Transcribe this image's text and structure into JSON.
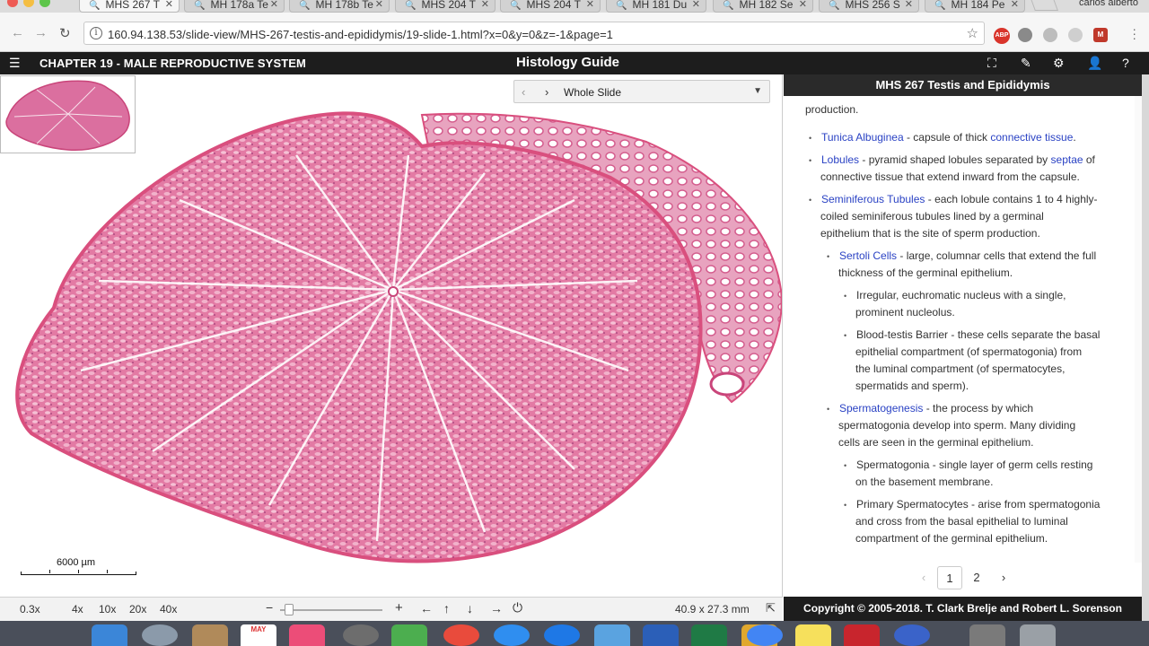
{
  "browser": {
    "tabs": [
      {
        "label": "MHS 267 T",
        "active": true
      },
      {
        "label": "MH 178a Te",
        "active": false
      },
      {
        "label": "MH 178b Te",
        "active": false
      },
      {
        "label": "MHS 204 T",
        "active": false
      },
      {
        "label": "MHS 204 T",
        "active": false
      },
      {
        "label": "MH 181 Du",
        "active": false
      },
      {
        "label": "MH 182 Se",
        "active": false
      },
      {
        "label": "MHS 256 S",
        "active": false
      },
      {
        "label": "MH 184 Pe",
        "active": false
      }
    ],
    "profile_name": "carlos alberto",
    "url": "160.94.138.53/slide-view/MHS-267-testis-and-epididymis/19-slide-1.html?x=0&y=0&z=-1&page=1",
    "extensions": [
      "ABP",
      "",
      "",
      "",
      "M"
    ]
  },
  "header": {
    "chapter": "CHAPTER 19 - MALE REPRODUCTIVE SYSTEM",
    "brand": "Histology Guide"
  },
  "viewer": {
    "slide_name": "Whole Slide",
    "scale_label": "6000 µm"
  },
  "panel": {
    "title": "MHS 267 Testis and Epididymis",
    "lines": [
      {
        "indent": 0,
        "bullet": false,
        "parts": [
          {
            "t": "production.",
            "link": false
          }
        ]
      },
      {
        "indent": 1,
        "bullet": true,
        "parts": [
          {
            "t": "Tunica Albuginea",
            "link": true
          },
          {
            "t": " - capsule of thick ",
            "link": false
          },
          {
            "t": "connective tissue",
            "link": true
          },
          {
            "t": ".",
            "link": false
          }
        ]
      },
      {
        "indent": 1,
        "bullet": true,
        "parts": [
          {
            "t": "Lobules",
            "link": true
          },
          {
            "t": " - pyramid shaped lobules separated by ",
            "link": false
          },
          {
            "t": "septae",
            "link": true
          },
          {
            "t": " of",
            "link": false
          }
        ]
      },
      {
        "indent": 1,
        "bullet": false,
        "parts": [
          {
            "t": "connective tissue that extend inward from the capsule.",
            "link": false
          }
        ]
      },
      {
        "indent": 1,
        "bullet": true,
        "parts": [
          {
            "t": "Seminiferous Tubules",
            "link": true
          },
          {
            "t": " - each lobule contains 1 to 4 highly-",
            "link": false
          }
        ]
      },
      {
        "indent": 1,
        "bullet": false,
        "parts": [
          {
            "t": "coiled seminiferous tubules lined by a germinal",
            "link": false
          }
        ]
      },
      {
        "indent": 1,
        "bullet": false,
        "parts": [
          {
            "t": "epithelium that is the site of sperm production.",
            "link": false
          }
        ]
      },
      {
        "indent": 2,
        "bullet": true,
        "parts": [
          {
            "t": "Sertoli Cells",
            "link": true
          },
          {
            "t": " - large, columnar cells that extend the full",
            "link": false
          }
        ]
      },
      {
        "indent": 2,
        "bullet": false,
        "parts": [
          {
            "t": "thickness of the germinal epithelium.",
            "link": false
          }
        ]
      },
      {
        "indent": 3,
        "bullet": true,
        "parts": [
          {
            "t": "Irregular, euchromatic nucleus with a single,",
            "link": false
          }
        ]
      },
      {
        "indent": 3,
        "bullet": false,
        "parts": [
          {
            "t": "prominent nucleolus.",
            "link": false
          }
        ]
      },
      {
        "indent": 3,
        "bullet": true,
        "parts": [
          {
            "t": "Blood-testis Barrier - these cells separate the basal",
            "link": false
          }
        ]
      },
      {
        "indent": 3,
        "bullet": false,
        "parts": [
          {
            "t": "epithelial compartment (of spermatogonia) from",
            "link": false
          }
        ]
      },
      {
        "indent": 3,
        "bullet": false,
        "parts": [
          {
            "t": "the luminal compartment (of spermatocytes,",
            "link": false
          }
        ]
      },
      {
        "indent": 3,
        "bullet": false,
        "parts": [
          {
            "t": "spermatids and sperm).",
            "link": false
          }
        ]
      },
      {
        "indent": 2,
        "bullet": true,
        "parts": [
          {
            "t": "Spermatogenesis",
            "link": true
          },
          {
            "t": " - the process by which",
            "link": false
          }
        ]
      },
      {
        "indent": 2,
        "bullet": false,
        "parts": [
          {
            "t": "spermatogonia develop into sperm. Many dividing",
            "link": false
          }
        ]
      },
      {
        "indent": 2,
        "bullet": false,
        "parts": [
          {
            "t": "cells are seen in the germinal epithelium.",
            "link": false
          }
        ]
      },
      {
        "indent": 3,
        "bullet": true,
        "parts": [
          {
            "t": "Spermatogonia - single layer of germ cells resting",
            "link": false
          }
        ]
      },
      {
        "indent": 3,
        "bullet": false,
        "parts": [
          {
            "t": "on the basement membrane.",
            "link": false
          }
        ]
      },
      {
        "indent": 3,
        "bullet": true,
        "parts": [
          {
            "t": "Primary Spermatocytes - arise from spermatogonia",
            "link": false
          }
        ]
      },
      {
        "indent": 3,
        "bullet": false,
        "parts": [
          {
            "t": "and cross from the basal epithelial to luminal",
            "link": false
          }
        ]
      },
      {
        "indent": 3,
        "bullet": false,
        "parts": [
          {
            "t": "compartment of the germinal epithelium.",
            "link": false
          }
        ]
      }
    ],
    "pages": [
      "1",
      "2"
    ],
    "current_page": "1"
  },
  "toolbar": {
    "zoom_level": "0.3x",
    "zoom_presets": [
      "4x",
      "10x",
      "20x",
      "40x"
    ],
    "dimensions": "40.9 x 27.3 mm",
    "zoom_slider_fraction": 0.05
  },
  "footer": {
    "copyright": "Copyright © 2005-2018. T. Clark Brelje and Robert L. Sorenson"
  },
  "dock": {
    "calendar_month": "MAY"
  },
  "colors": {
    "link": "#2a42c4",
    "header_bg": "#1d1d1d",
    "tissue_pink": "#e0689a",
    "tissue_border": "#d94f7e"
  }
}
